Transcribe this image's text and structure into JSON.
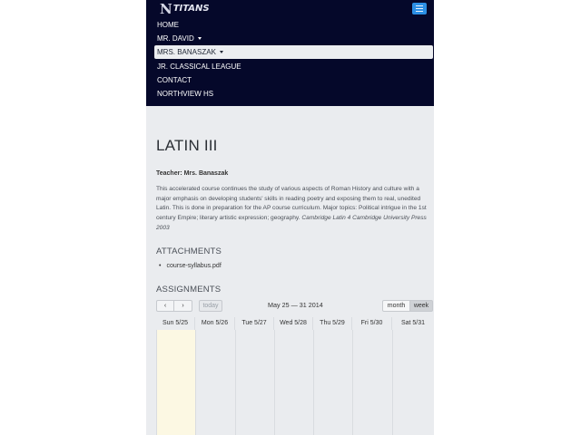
{
  "brand": {
    "logo_letter": "N",
    "name": "TITANS"
  },
  "nav": {
    "items": [
      {
        "label": "HOME",
        "dropdown": false,
        "active": false
      },
      {
        "label": "MR. DAVID",
        "dropdown": true,
        "active": false
      },
      {
        "label": "MRS. BANASZAK",
        "dropdown": true,
        "active": true
      },
      {
        "label": "JR. CLASSICAL LEAGUE",
        "dropdown": false,
        "active": false
      },
      {
        "label": "CONTACT",
        "dropdown": false,
        "active": false
      },
      {
        "label": "NORTHVIEW HS",
        "dropdown": false,
        "active": false
      }
    ]
  },
  "course": {
    "title": "LATIN III",
    "teacher": "Teacher: Mrs. Banaszak",
    "description": "This accelerated course continues the study of various aspects of Roman History and culture with a major emphasis on developing students' skills in reading poetry and exposing them to real, unedited Latin. This is done in preparation for the AP course curriculum. Major topics: Political intrigue in the 1st century Empire; literary artistic expression; geography. ",
    "textbook": "Cambridge Latin 4 Cambridge University Press 2003"
  },
  "attachments": {
    "heading": "ATTACHMENTS",
    "files": [
      "course-syllabus.pdf"
    ]
  },
  "assignments": {
    "heading": "ASSIGNMENTS",
    "prev_label": "‹",
    "next_label": "›",
    "today_label": "today",
    "range": "May 25 — 31 2014",
    "view_month": "month",
    "view_week": "week",
    "days": [
      "Sun 5/25",
      "Mon 5/26",
      "Tue 5/27",
      "Wed 5/28",
      "Thu 5/29",
      "Fri 5/30",
      "Sat 5/31"
    ],
    "today_index": 0
  },
  "colors": {
    "navbar": "#05082a",
    "toggle": "#2c8fe4",
    "today_highlight": "#fcf8e3",
    "page_bg": "#eaecef"
  }
}
